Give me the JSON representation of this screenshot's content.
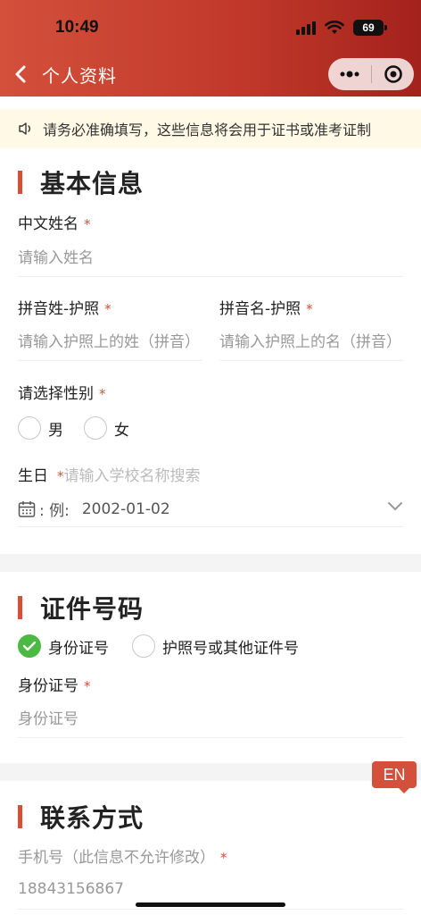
{
  "status": {
    "time": "10:49",
    "battery": "69"
  },
  "nav": {
    "title": "个人资料"
  },
  "notice": {
    "text": "请务必准确填写，这些信息将会用于证书或准考证制"
  },
  "basic": {
    "title": "基本信息",
    "chinese_name": {
      "label": "中文姓名",
      "required": "*",
      "placeholder": "请输入姓名"
    },
    "pinyin_last": {
      "label": "拼音姓-护照",
      "required": "*",
      "placeholder": "请输入护照上的姓（拼音）"
    },
    "pinyin_first": {
      "label": "拼音名-护照",
      "required": "*",
      "placeholder": "请输入护照上的名（拼音）"
    },
    "gender": {
      "label": "请选择性别",
      "required": "*",
      "options": [
        "男",
        "女"
      ]
    },
    "birthday": {
      "label": "生日",
      "required": "*",
      "hint": "请输入学校名称搜索",
      "prefix": ": 例:",
      "value": "2002-01-02"
    }
  },
  "idnum": {
    "title": "证件号码",
    "options": [
      "身份证号",
      "护照号或其他证件号"
    ],
    "selected": "身份证号",
    "field": {
      "label": "身份证号",
      "required": "*",
      "placeholder": "身份证号"
    }
  },
  "contact": {
    "title": "联系方式",
    "phone": {
      "label": "手机号（此信息不允许修改）",
      "required": "*",
      "value": "18843156867"
    }
  },
  "lang_badge": "EN",
  "colors": {
    "accent": "#d4503b",
    "check": "#4cb945",
    "notice_bg": "#fff9e6"
  }
}
